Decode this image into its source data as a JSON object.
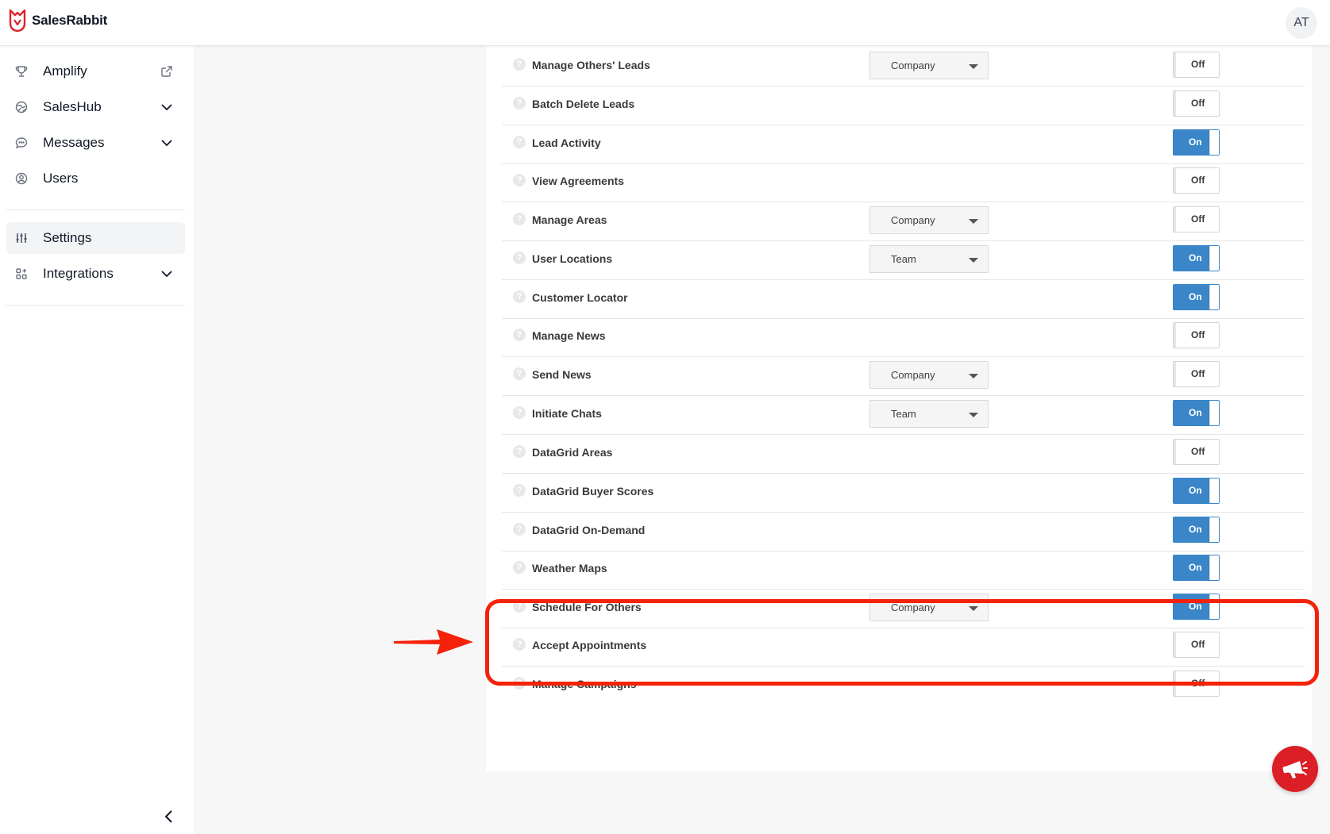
{
  "app": {
    "brand": "SalesRabbit",
    "user_initials": "AT"
  },
  "sidebar": {
    "items": [
      {
        "label": "Amplify",
        "icon": "trophy-icon",
        "trailing": "external-link-icon"
      },
      {
        "label": "SalesHub",
        "icon": "globe-icon",
        "trailing": "chevron-down-icon"
      },
      {
        "label": "Messages",
        "icon": "chat-bubble-icon",
        "trailing": "chevron-down-icon"
      },
      {
        "label": "Users",
        "icon": "user-circle-icon",
        "trailing": ""
      },
      {
        "label": "Settings",
        "icon": "sliders-icon",
        "trailing": "",
        "active": true
      },
      {
        "label": "Integrations",
        "icon": "grid-icon",
        "trailing": "chevron-down-icon"
      }
    ]
  },
  "permissions": {
    "rows": [
      {
        "label": "Manage Others' Leads",
        "scope": "Company",
        "toggle": "Off"
      },
      {
        "label": "Batch Delete Leads",
        "scope": "",
        "toggle": "Off"
      },
      {
        "label": "Lead Activity",
        "scope": "",
        "toggle": "On"
      },
      {
        "label": "View Agreements",
        "scope": "",
        "toggle": "Off"
      },
      {
        "label": "Manage Areas",
        "scope": "Company",
        "toggle": "Off"
      },
      {
        "label": "User Locations",
        "scope": "Team",
        "toggle": "On"
      },
      {
        "label": "Customer Locator",
        "scope": "",
        "toggle": "On"
      },
      {
        "label": "Manage News",
        "scope": "",
        "toggle": "Off"
      },
      {
        "label": "Send News",
        "scope": "Company",
        "toggle": "Off"
      },
      {
        "label": "Initiate Chats",
        "scope": "Team",
        "toggle": "On"
      },
      {
        "label": "DataGrid Areas",
        "scope": "",
        "toggle": "Off"
      },
      {
        "label": "DataGrid Buyer Scores",
        "scope": "",
        "toggle": "On"
      },
      {
        "label": "DataGrid On-Demand",
        "scope": "",
        "toggle": "On"
      },
      {
        "label": "Weather Maps",
        "scope": "",
        "toggle": "On"
      },
      {
        "label": "Schedule For Others",
        "scope": "Company",
        "toggle": "On"
      },
      {
        "label": "Accept Appointments",
        "scope": "",
        "toggle": "Off"
      },
      {
        "label": "Manage Campaigns",
        "scope": "",
        "toggle": "Off"
      }
    ],
    "help_glyph": "?"
  },
  "colors": {
    "toggle_on": "#3a86c8",
    "annotation": "#f5220a",
    "announce_button": "#dc1f26",
    "brand": "#e0242b"
  }
}
